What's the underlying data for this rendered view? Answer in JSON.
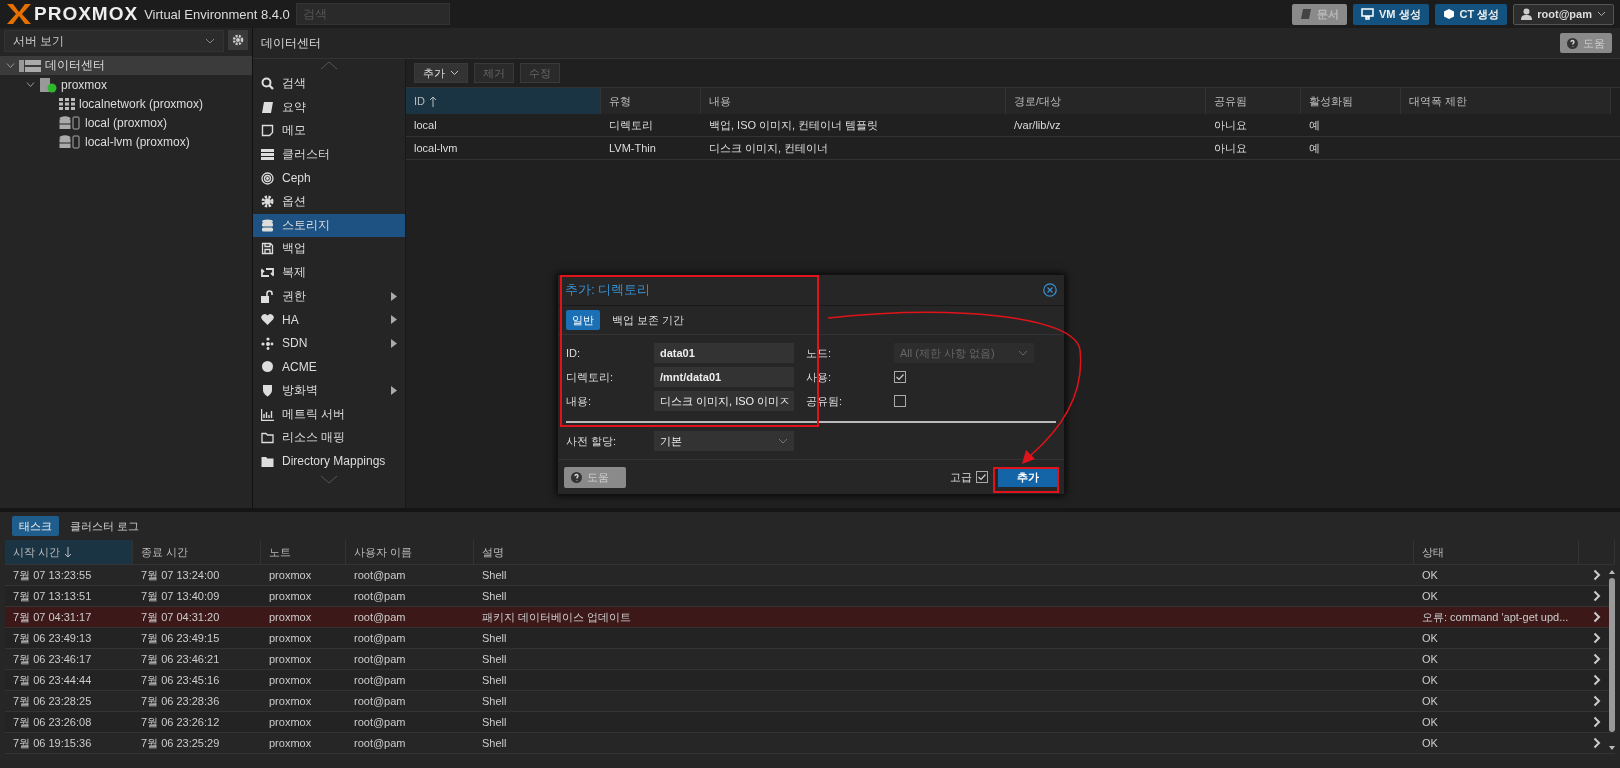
{
  "topbar": {
    "logo": "PROXMOX",
    "version": "Virtual Environment 8.4.0",
    "search": {
      "placeholder": "검색"
    },
    "buttons": [
      {
        "label": "문서",
        "kind": "docs"
      },
      {
        "label": "VM 생성",
        "kind": "vm"
      },
      {
        "label": "CT 생성",
        "kind": "ct"
      },
      {
        "label": "root@pam",
        "kind": "user"
      }
    ]
  },
  "sidebar": {
    "view": "서버 보기",
    "tree": [
      {
        "label": "데이터센터",
        "kind": "datacenter",
        "selected": true,
        "expanded": true,
        "children": [
          {
            "label": "proxmox",
            "kind": "node",
            "selected": false,
            "expanded": true,
            "children": [
              {
                "label": "localnetwork (proxmox)",
                "kind": "network",
                "selected": false
              },
              {
                "label": "local (proxmox)",
                "kind": "storage",
                "selected": false
              },
              {
                "label": "local-lvm (proxmox)",
                "kind": "storage",
                "selected": false
              }
            ]
          }
        ]
      }
    ]
  },
  "content": {
    "title": "데이터센터",
    "help": "도움",
    "menu": [
      {
        "label": "검색",
        "kind": "search",
        "selected": false,
        "submenu": false
      },
      {
        "label": "요약",
        "kind": "book",
        "selected": false,
        "submenu": false
      },
      {
        "label": "메모",
        "kind": "note",
        "selected": false,
        "submenu": false
      },
      {
        "label": "클러스터",
        "kind": "server",
        "selected": false,
        "submenu": false
      },
      {
        "label": "Ceph",
        "kind": "ceph",
        "selected": false,
        "submenu": false
      },
      {
        "label": "옵션",
        "kind": "gear",
        "selected": false,
        "submenu": false
      },
      {
        "label": "스토리지",
        "kind": "db",
        "selected": true,
        "submenu": false
      },
      {
        "label": "백업",
        "kind": "floppy",
        "selected": false,
        "submenu": false
      },
      {
        "label": "복제",
        "kind": "retweet",
        "selected": false,
        "submenu": false
      },
      {
        "label": "권한",
        "kind": "unlock",
        "selected": false,
        "submenu": true
      },
      {
        "label": "HA",
        "kind": "heart",
        "selected": false,
        "submenu": true
      },
      {
        "label": "SDN",
        "kind": "sdn",
        "selected": false,
        "submenu": true
      },
      {
        "label": "ACME",
        "kind": "badge",
        "selected": false,
        "submenu": false
      },
      {
        "label": "방화벽",
        "kind": "shield",
        "selected": false,
        "submenu": true
      },
      {
        "label": "메트릭 서버",
        "kind": "chart",
        "selected": false,
        "submenu": false
      },
      {
        "label": "리소스 매핑",
        "kind": "folder",
        "selected": false,
        "submenu": false
      },
      {
        "label": "Directory Mappings",
        "kind": "folderfill",
        "selected": false,
        "submenu": false
      }
    ],
    "toolbar": [
      {
        "label": "추가",
        "disabled": false,
        "dropdown": true
      },
      {
        "label": "제거",
        "disabled": true,
        "dropdown": false
      },
      {
        "label": "수정",
        "disabled": true,
        "dropdown": false
      }
    ],
    "table": {
      "columns": [
        {
          "label": "ID",
          "sorted": true,
          "ascending": true
        },
        {
          "label": "유형"
        },
        {
          "label": "내용"
        },
        {
          "label": "경로/대상"
        },
        {
          "label": "공유됨"
        },
        {
          "label": "활성화됨"
        },
        {
          "label": "대역폭 제한"
        }
      ],
      "rows": [
        [
          "local",
          "디렉토리",
          "백업, ISO 이미지, 컨테이너 템플릿",
          "/var/lib/vz",
          "아니요",
          "예",
          ""
        ],
        [
          "local-lvm",
          "LVM-Thin",
          "디스크 이미지, 컨테이너",
          "",
          "아니요",
          "예",
          ""
        ]
      ]
    }
  },
  "dialog": {
    "title": "추가: 디렉토리",
    "tabs": [
      {
        "label": "일반",
        "selected": true
      },
      {
        "label": "백업 보존 기간",
        "selected": false
      }
    ],
    "left": [
      {
        "label": "ID:",
        "kind": "text",
        "value": "data01"
      },
      {
        "label": "디렉토리:",
        "kind": "text",
        "value": "/mnt/data01"
      },
      {
        "label": "내용:",
        "kind": "select",
        "value": "디스크 이미지, ISO 이미ㅈ"
      }
    ],
    "right": [
      {
        "label": "노드:",
        "kind": "select",
        "value": "All (제한 사항 없음)",
        "disabled": true
      },
      {
        "label": "사용:",
        "kind": "check",
        "checked": true
      },
      {
        "label": "공유됨:",
        "kind": "check",
        "checked": false
      }
    ],
    "advanced_fields": [
      {
        "label": "사전 할당:",
        "kind": "select",
        "value": "기본"
      }
    ],
    "help": "도움",
    "advanced": {
      "label": "고급",
      "checked": true
    },
    "submit": "추가"
  },
  "tasks": {
    "tabs": [
      {
        "label": "태스크",
        "selected": true
      },
      {
        "label": "클러스터 로그",
        "selected": false
      }
    ],
    "columns": [
      {
        "label": "시작 시간",
        "sorted": true,
        "ascending": false
      },
      {
        "label": "종료 시간"
      },
      {
        "label": "노트"
      },
      {
        "label": "사용자 이름"
      },
      {
        "label": "설명"
      },
      {
        "label": "상태"
      }
    ],
    "rows": [
      {
        "cells": [
          "7월 07 13:23:55",
          "7월 07 13:24:00",
          "proxmox",
          "root@pam",
          "Shell",
          "OK"
        ],
        "error": false
      },
      {
        "cells": [
          "7월 07 13:13:51",
          "7월 07 13:40:09",
          "proxmox",
          "root@pam",
          "Shell",
          "OK"
        ],
        "error": false
      },
      {
        "cells": [
          "7월 07 04:31:17",
          "7월 07 04:31:20",
          "proxmox",
          "root@pam",
          "패키지 데이터베이스 업데이트",
          "오류: command 'apt-get upd..."
        ],
        "error": true
      },
      {
        "cells": [
          "7월 06 23:49:13",
          "7월 06 23:49:15",
          "proxmox",
          "root@pam",
          "Shell",
          "OK"
        ],
        "error": false
      },
      {
        "cells": [
          "7월 06 23:46:17",
          "7월 06 23:46:21",
          "proxmox",
          "root@pam",
          "Shell",
          "OK"
        ],
        "error": false
      },
      {
        "cells": [
          "7월 06 23:44:44",
          "7월 06 23:45:16",
          "proxmox",
          "root@pam",
          "Shell",
          "OK"
        ],
        "error": false
      },
      {
        "cells": [
          "7월 06 23:28:25",
          "7월 06 23:28:36",
          "proxmox",
          "root@pam",
          "Shell",
          "OK"
        ],
        "error": false
      },
      {
        "cells": [
          "7월 06 23:26:08",
          "7월 06 23:26:12",
          "proxmox",
          "root@pam",
          "Shell",
          "OK"
        ],
        "error": false
      },
      {
        "cells": [
          "7월 06 19:15:36",
          "7월 06 23:25:29",
          "proxmox",
          "root@pam",
          "Shell",
          "OK"
        ],
        "error": false
      }
    ]
  }
}
